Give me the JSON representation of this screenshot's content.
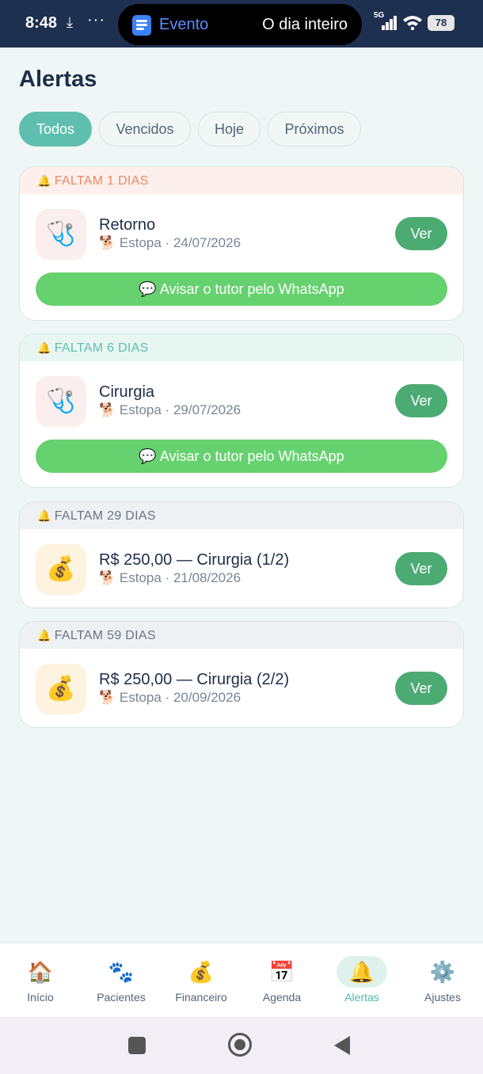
{
  "status_bar": {
    "time": "8:48",
    "download_icon": "download-icon",
    "more_dots": "···",
    "network": "5G",
    "battery": "78",
    "live_activity": {
      "title": "Evento",
      "detail": "O dia inteiro"
    }
  },
  "page": {
    "title": "Alertas"
  },
  "filters": [
    {
      "label": "Todos",
      "active": true
    },
    {
      "label": "Vencidos",
      "active": false
    },
    {
      "label": "Hoje",
      "active": false
    },
    {
      "label": "Próximos",
      "active": false
    }
  ],
  "alerts": [
    {
      "header": "FALTAM 1 DIAS",
      "bell": "🔔",
      "icon_emoji": "🩺",
      "icon_name": "stethoscope-icon",
      "title": "Retorno",
      "pet_emoji": "🐕",
      "subtitle": "Estopa · 24/07/2026",
      "view_label": "Ver",
      "whatsapp_label": "💬 Avisar o tutor pelo WhatsApp"
    },
    {
      "header": "FALTAM 6 DIAS",
      "bell": "🔔",
      "icon_emoji": "🩺",
      "icon_name": "stethoscope-icon",
      "title": "Cirurgia",
      "pet_emoji": "🐕",
      "subtitle": "Estopa · 29/07/2026",
      "view_label": "Ver",
      "whatsapp_label": "💬 Avisar o tutor pelo WhatsApp"
    },
    {
      "header": "FALTAM 29 DIAS",
      "bell": "🔔",
      "icon_emoji": "💰",
      "icon_name": "money-bag-icon",
      "title": "R$ 250,00 — Cirurgia (1/2)",
      "pet_emoji": "🐕",
      "subtitle": "Estopa · 21/08/2026",
      "view_label": "Ver"
    },
    {
      "header": "FALTAM 59 DIAS",
      "bell": "🔔",
      "icon_emoji": "💰",
      "icon_name": "money-bag-icon",
      "title": "R$ 250,00 — Cirurgia (2/2)",
      "pet_emoji": "🐕",
      "subtitle": "Estopa · 20/09/2026",
      "view_label": "Ver"
    }
  ],
  "bottom_nav": [
    {
      "label": "Início",
      "emoji": "🏠",
      "icon": "home-icon",
      "active": false
    },
    {
      "label": "Pacientes",
      "emoji": "🐾",
      "icon": "paw-icon",
      "active": false
    },
    {
      "label": "Financeiro",
      "emoji": "💰",
      "icon": "money-bag-icon",
      "active": false
    },
    {
      "label": "Agenda",
      "emoji": "📅",
      "icon": "calendar-icon",
      "active": false
    },
    {
      "label": "Alertas",
      "emoji": "🔔",
      "icon": "bell-icon",
      "active": true
    },
    {
      "label": "Ajustes",
      "emoji": "⚙️",
      "icon": "gear-icon",
      "active": false
    }
  ],
  "colors": {
    "accent": "#5fbfae",
    "ver_button": "#4cab72",
    "whatsapp_button": "#66d16f",
    "urgent_header_text": "#e98a6a",
    "background": "#eef7f5"
  }
}
